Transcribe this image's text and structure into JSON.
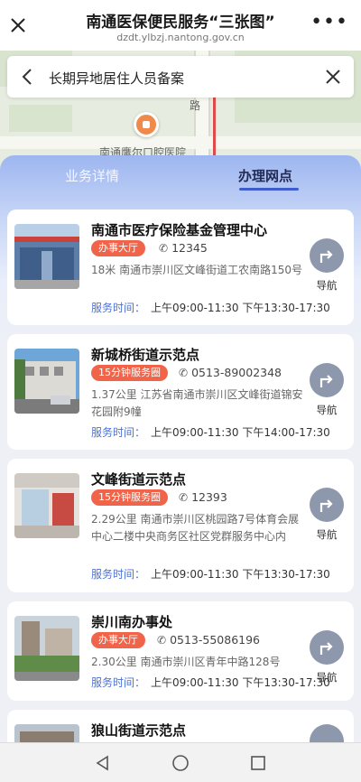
{
  "header": {
    "title": "南通医保便民服务“三张图”",
    "url": "dzdt.ylbzj.nantong.gov.cn"
  },
  "map": {
    "place_label": "南通鹰尔口腔医院",
    "road_label": "路"
  },
  "search": {
    "title": "长期异地居住人员备案"
  },
  "tabs": [
    {
      "label": "业务详情",
      "active": false
    },
    {
      "label": "办理网点",
      "active": true
    }
  ],
  "cards": [
    {
      "name": "南通市医疗保险基金管理中心",
      "badge": "办事大厅",
      "phone": "12345",
      "address": "18米  南通市崇川区文峰街道工农南路150号",
      "hours_label": "服务时间：",
      "hours": "上午09:00-11:30 下午13:30-17:30",
      "nav_label": "导航"
    },
    {
      "name": "新城桥街道示范点",
      "badge": "15分钟服务圈",
      "phone": "0513-89002348",
      "address": "1.37公里  江苏省南通市崇川区文峰街道锦安花园附9幢",
      "hours_label": "服务时间：",
      "hours": "上午09:00-11:30 下午14:00-17:30",
      "nav_label": "导航"
    },
    {
      "name": "文峰街道示范点",
      "badge": "15分钟服务圈",
      "phone": "12393",
      "address": "2.29公里  南通市崇川区桃园路7号体育会展中心二楼中央商务区社区党群服务中心内",
      "hours_label": "服务时间：",
      "hours": "上午09:00-11:30 下午13:30-17:30",
      "nav_label": "导航"
    },
    {
      "name": "崇川南办事处",
      "badge": "办事大厅",
      "phone": "0513-55086196",
      "address": "2.30公里  南通市崇川区青年中路128号",
      "hours_label": "服务时间：",
      "hours": "上午09:00-11:30 下午13:30-17:30",
      "nav_label": "导航"
    },
    {
      "name": "狼山街道示范点",
      "badge": "",
      "phone": "",
      "address": "",
      "hours_label": "",
      "hours": "",
      "nav_label": ""
    }
  ],
  "colors": {
    "accent": "#3e5ccc",
    "badge": "#f0644a",
    "hours_label": "#4d72d6",
    "nav_button": "#8e98ad"
  },
  "icons": {
    "close": "close-icon",
    "more": "more-icon",
    "back": "back-arrow-icon",
    "clear": "clear-icon",
    "phone": "phone-icon",
    "navigate": "navigate-arrow-icon"
  }
}
